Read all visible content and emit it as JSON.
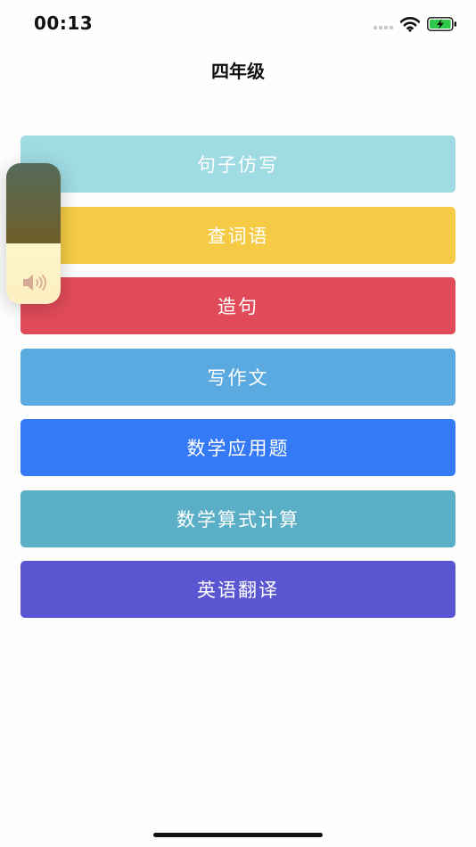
{
  "status_bar": {
    "time": "00:13",
    "icons": [
      "cellular-signal-icon",
      "wifi-icon",
      "battery-charging-icon"
    ],
    "battery_color": "#2ec84a"
  },
  "header": {
    "title": "四年级"
  },
  "menu": {
    "items": [
      {
        "label": "句子仿写",
        "color": "#9fdbe3"
      },
      {
        "label": "查词语",
        "color": "#f5cb46"
      },
      {
        "label": "造句",
        "color": "#e14b59"
      },
      {
        "label": "写作文",
        "color": "#5aaae1"
      },
      {
        "label": "数学应用题",
        "color": "#3479f5"
      },
      {
        "label": "数学算式计算",
        "color": "#5aafc6"
      },
      {
        "label": "英语翻译",
        "color": "#5a56d2"
      }
    ]
  },
  "volume_overlay": {
    "icon": "speaker-icon",
    "level": 0.43
  }
}
